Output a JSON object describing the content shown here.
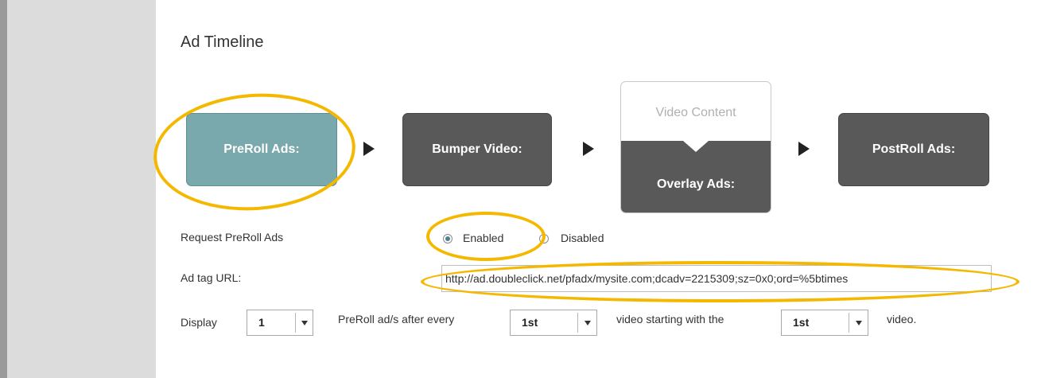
{
  "page": {
    "title": "Ad Timeline"
  },
  "timeline": {
    "preroll_label": "PreRoll Ads:",
    "bumper_label": "Bumper Video:",
    "video_content_label": "Video Content",
    "overlay_label": "Overlay Ads:",
    "postroll_label": "PostRoll Ads:"
  },
  "request_preroll": {
    "label": "Request PreRoll Ads",
    "options": [
      {
        "label": "Enabled",
        "checked": true
      },
      {
        "label": "Disabled",
        "checked": false
      }
    ]
  },
  "ad_tag": {
    "label": "Ad tag URL:",
    "value": "http://ad.doubleclick.net/pfadx/mysite.com;dcadv=2215309;sz=0x0;ord=%5btimes"
  },
  "display_row": {
    "display_label": "Display",
    "count_value": "1",
    "after_every_label": "PreRoll ad/s after every",
    "every_value": "1st",
    "starting_label": "video starting with the",
    "starting_value": "1st",
    "video_label": "video."
  },
  "colors": {
    "preroll": "#79a8ad",
    "stage_dark": "#595959",
    "callout": "#f5b800"
  }
}
